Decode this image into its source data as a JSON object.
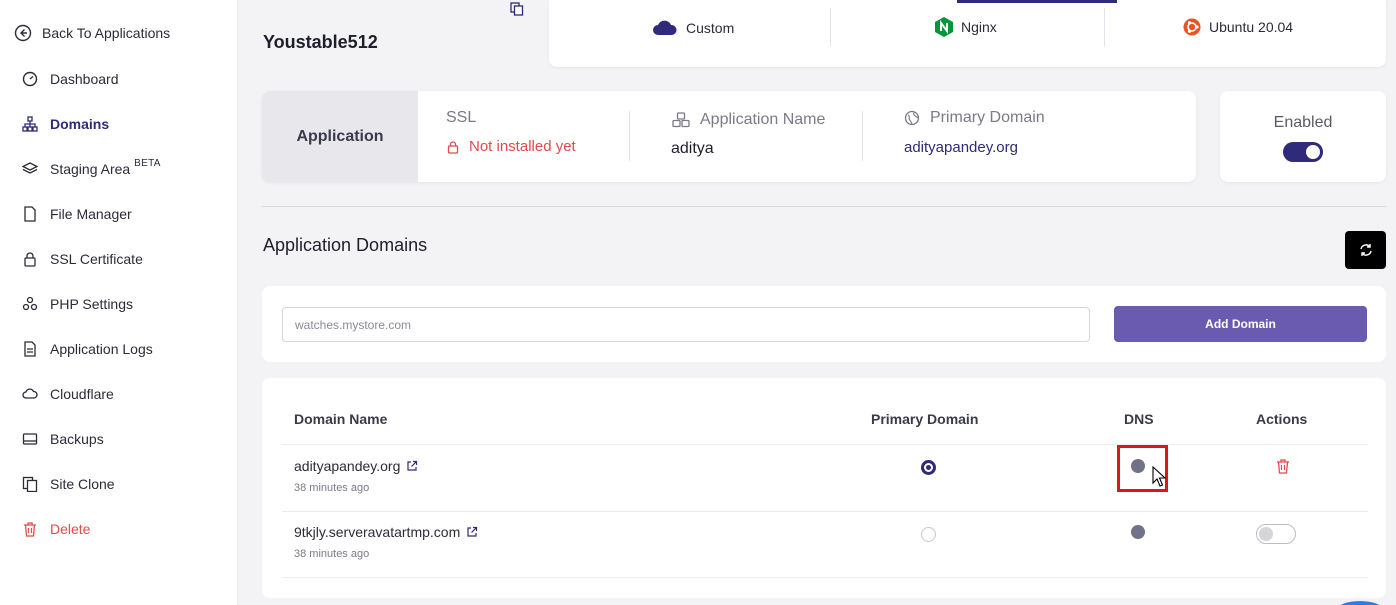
{
  "sidebar": {
    "back_label": "Back To Applications",
    "items": [
      {
        "label": "Dashboard",
        "icon": "gauge-icon"
      },
      {
        "label": "Domains",
        "icon": "sitemap-icon",
        "active": true
      },
      {
        "label": "Staging Area",
        "badge": "BETA",
        "icon": "layers-icon"
      },
      {
        "label": "File Manager",
        "icon": "file-icon"
      },
      {
        "label": "SSL Certificate",
        "icon": "lock-icon"
      },
      {
        "label": "PHP Settings",
        "icon": "cogs-icon"
      },
      {
        "label": "Application Logs",
        "icon": "file-text-icon"
      },
      {
        "label": "Cloudflare",
        "icon": "cloud-icon"
      },
      {
        "label": "Backups",
        "icon": "box-icon"
      },
      {
        "label": "Site Clone",
        "icon": "copy-icon"
      },
      {
        "label": "Delete",
        "icon": "trash-icon"
      }
    ]
  },
  "header": {
    "app_name": "Youstable512",
    "stack": [
      {
        "label": "Custom",
        "icon": "cloud-icon"
      },
      {
        "label": "Nginx",
        "icon": "nginx-icon"
      },
      {
        "label": "Ubuntu 20.04",
        "icon": "ubuntu-icon"
      }
    ]
  },
  "app_card": {
    "title": "Application",
    "ssl_label": "SSL",
    "ssl_value": "Not installed yet",
    "name_label": "Application Name",
    "name_value": "aditya",
    "domain_label": "Primary Domain",
    "domain_value": "adityapandey.org",
    "enabled_label": "Enabled"
  },
  "domains_section": {
    "title": "Application Domains",
    "input_placeholder": "watches.mystore.com",
    "add_button": "Add Domain",
    "columns": [
      "Domain Name",
      "Primary Domain",
      "DNS",
      "Actions"
    ],
    "rows": [
      {
        "domain": "adityapandey.org",
        "time": "38 minutes ago",
        "primary": true
      },
      {
        "domain": "9tkjly.serveravatartmp.com",
        "time": "38 minutes ago",
        "primary": false
      }
    ]
  },
  "colors": {
    "accent": "#2f2a7a",
    "button": "#6b5bb0",
    "danger": "#e5484d",
    "highlight": "#e0141b"
  }
}
